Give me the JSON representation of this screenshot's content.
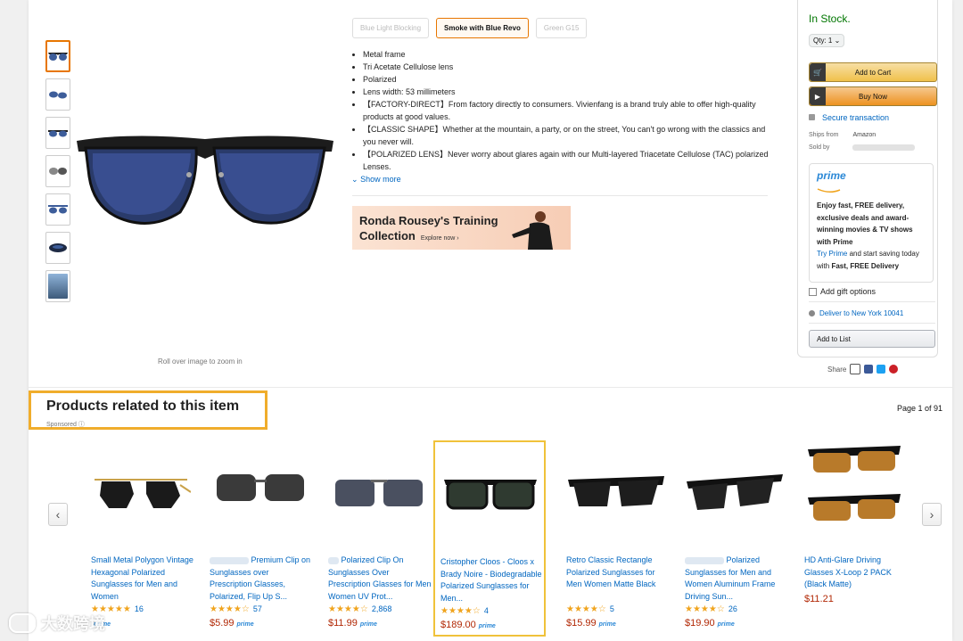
{
  "variants": [
    {
      "label": "Blue Light Blocking",
      "selected": false
    },
    {
      "label": "Smoke with Blue Revo",
      "selected": true
    },
    {
      "label": "Green G15",
      "selected": false
    }
  ],
  "bullets": [
    "Metal frame",
    "Tri Acetate Cellulose lens",
    "Polarized",
    "Lens width: 53 millimeters",
    "【FACTORY-DIRECT】From factory directly to consumers. Vivienfang is a brand truly able to offer high-quality products at good values.",
    "【CLASSIC SHAPE】Whether at the mountain, a party, or on the street, You can't go wrong with the classics and you never will.",
    "【POLARIZED LENS】Never worry about glares again with our Multi-layered Triacetate Cellulose (TAC) polarized Lenses."
  ],
  "show_more": "Show more",
  "zoom_hint": "Roll over image to zoom in",
  "ad": {
    "line1": "Ronda Rousey's Training",
    "line2": "Collection",
    "explore": "Explore now ›"
  },
  "buybox": {
    "stock": "In Stock.",
    "qty": "Qty: 1",
    "add_to_cart": "Add to Cart",
    "buy_now": "Buy Now",
    "secure": "Secure transaction",
    "ships_from_label": "Ships from",
    "ships_from_value": "Amazon",
    "sold_by_label": "Sold by",
    "prime_logo": "prime",
    "prime_bold": "Enjoy fast, FREE delivery, exclusive deals and award-winning movies & TV shows with Prime",
    "prime_try": "Try Prime",
    "prime_rest": " and start saving today with ",
    "prime_fast": "Fast, FREE Delivery",
    "gift": "Add gift options",
    "deliver": "Deliver to New York 10041",
    "add_to_list": "Add to List",
    "share": "Share"
  },
  "related": {
    "title": "Products related to this item",
    "sponsored": "Sponsored",
    "page": "Page 1 of 91"
  },
  "products": [
    {
      "title": "Small Metal Polygon Vintage Hexagonal Polarized Sunglasses for Men and Women",
      "stars": "★★★★★",
      "count": "16",
      "price": "",
      "prime": "prime"
    },
    {
      "title": "Premium Clip on Sunglasses over Prescription Glasses, Polarized, Flip Up S...",
      "stars": "★★★★☆",
      "count": "57",
      "price": "$5.99",
      "prime": "prime"
    },
    {
      "title": "Polarized Clip On Sunglasses Over Prescription Glasses for Men Women UV Prot...",
      "stars": "★★★★☆",
      "count": "2,868",
      "price": "$11.99",
      "prime": "prime"
    },
    {
      "title": "Cristopher Cloos - Cloos x Brady Noire - Biodegradable Polarized Sunglasses for Men...",
      "stars": "★★★★☆",
      "count": "4",
      "price": "$189.00",
      "prime": "prime"
    },
    {
      "title": "Retro Classic Rectangle Polarized Sunglasses for Men Women Matte Black",
      "stars": "★★★★☆",
      "count": "5",
      "price": "$15.99",
      "prime": "prime"
    },
    {
      "title": "Polarized Sunglasses for Men and Women Aluminum Frame Driving Sun...",
      "stars": "★★★★☆",
      "count": "26",
      "price": "$19.90",
      "prime": "prime"
    },
    {
      "title": "HD Anti-Glare Driving Glasses X-Loop 2 PACK (Black Matte)",
      "stars": "",
      "count": "",
      "price": "$11.21",
      "prime": ""
    }
  ],
  "watermark": "大数跨境"
}
